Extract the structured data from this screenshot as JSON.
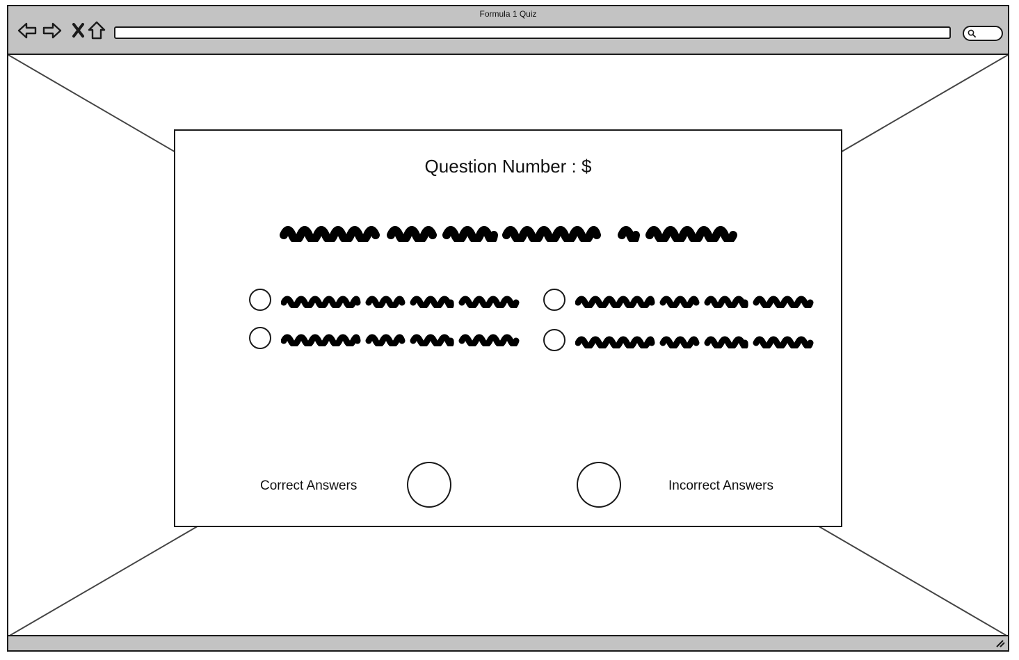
{
  "window": {
    "title": "Formula 1 Quiz",
    "address_value": ""
  },
  "quiz": {
    "question_number_label": "Question Number : $"
  },
  "score": {
    "correct_label": "Correct Answers",
    "incorrect_label": "Incorrect Answers"
  },
  "colors": {
    "chrome": "#c3c3c3",
    "ink": "#1a1a1a"
  }
}
